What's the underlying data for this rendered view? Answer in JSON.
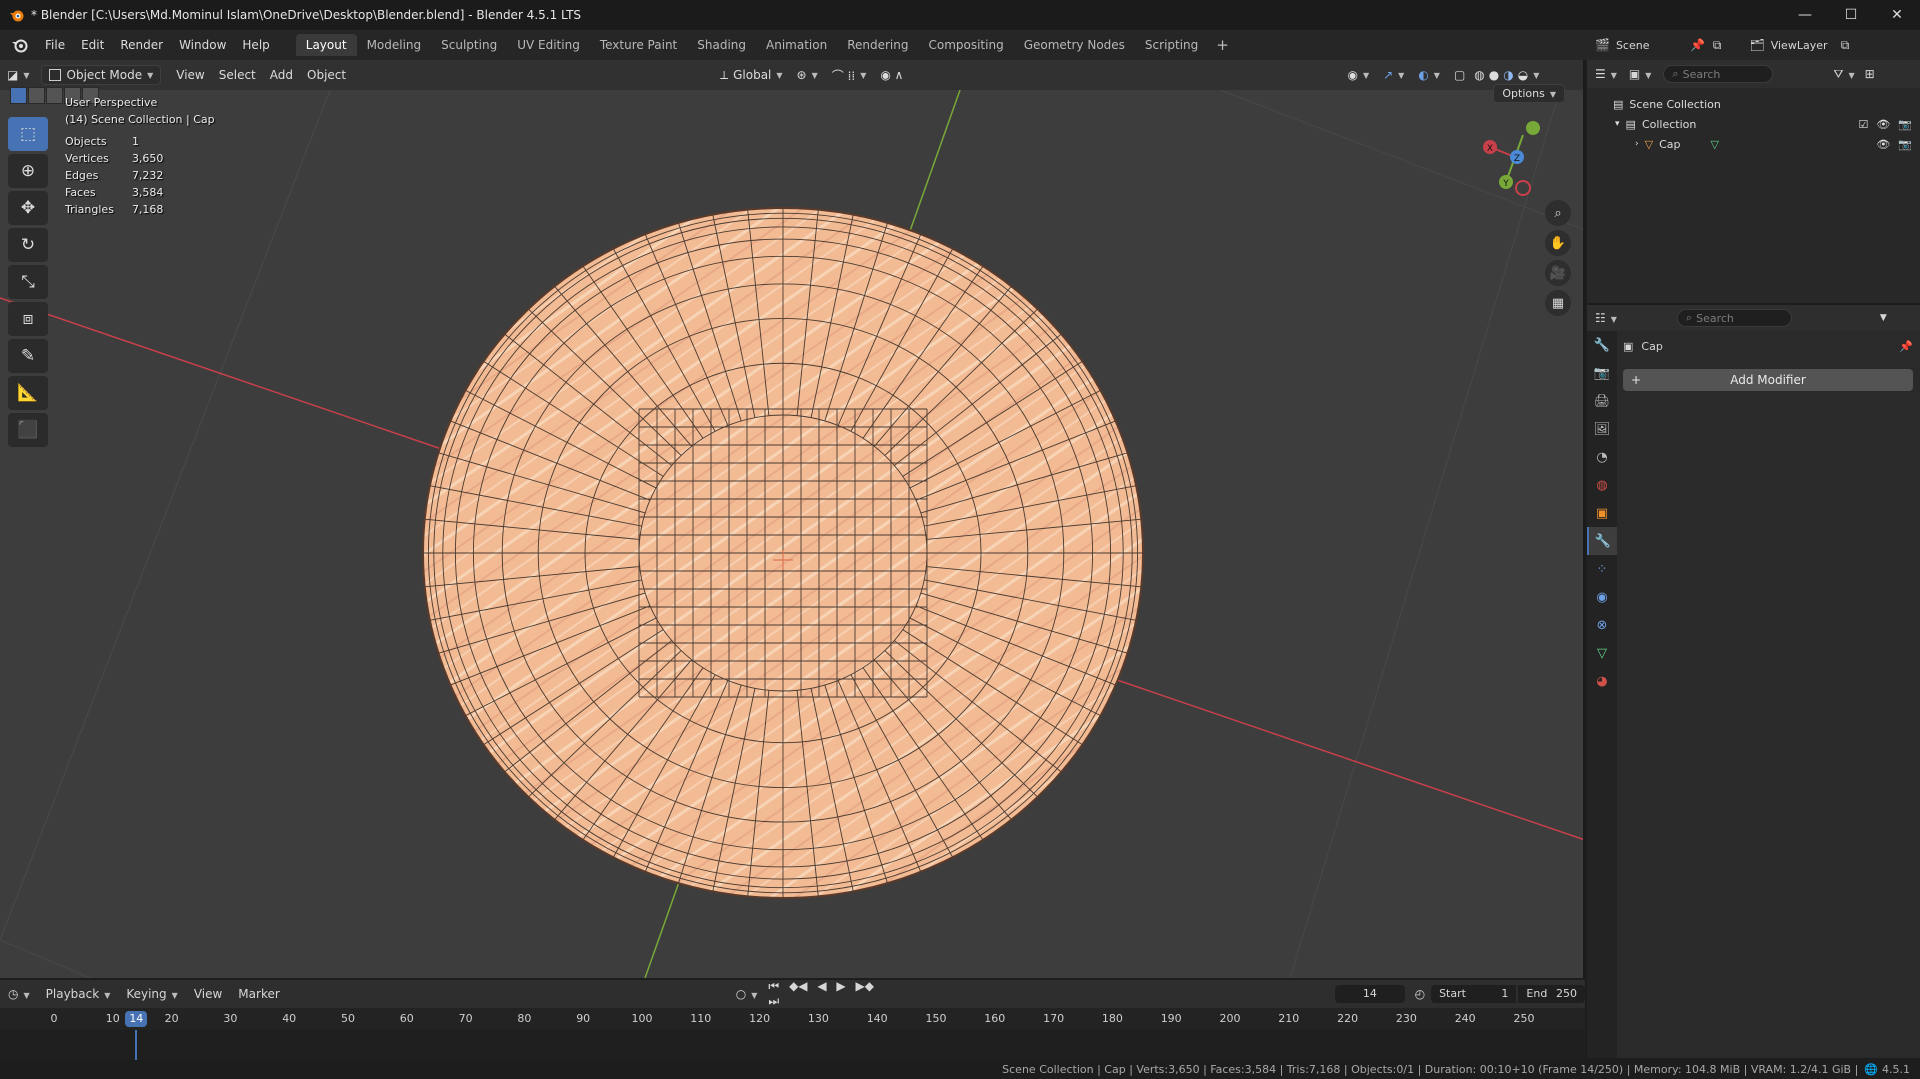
{
  "window": {
    "title": "* Blender [C:\\Users\\Md.Mominul Islam\\OneDrive\\Desktop\\Blender.blend] - Blender 4.5.1 LTS",
    "controls": [
      "—",
      "☐",
      "✕"
    ]
  },
  "menubar": {
    "menus": [
      "File",
      "Edit",
      "Render",
      "Window",
      "Help"
    ],
    "workspaces": [
      "Layout",
      "Modeling",
      "Sculpting",
      "UV Editing",
      "Texture Paint",
      "Shading",
      "Animation",
      "Rendering",
      "Compositing",
      "Geometry Nodes",
      "Scripting"
    ],
    "active_workspace": "Layout",
    "add_label": "+"
  },
  "viewport": {
    "mode": "Object Mode",
    "menus": [
      "View",
      "Select",
      "Add",
      "Object"
    ],
    "transform_orientation": "Global",
    "options_label": "Options",
    "overlay": {
      "perspective": "User Perspective",
      "context": "(14) Scene Collection | Cap",
      "stats": [
        {
          "label": "Objects",
          "value": "1"
        },
        {
          "label": "Vertices",
          "value": "3,650"
        },
        {
          "label": "Edges",
          "value": "7,232"
        },
        {
          "label": "Faces",
          "value": "3,584"
        },
        {
          "label": "Triangles",
          "value": "7,168"
        }
      ]
    },
    "gizmo_axes": {
      "x": "X",
      "y": "Y",
      "z": "Z"
    },
    "colors": {
      "background": "#3d3d3d",
      "mesh": "#f2bb94",
      "x_axis": "#c8404a",
      "y_axis": "#78a838",
      "accent": "#4772b3"
    }
  },
  "timeline": {
    "menus": [
      "Playback",
      "Keying",
      "View",
      "Marker"
    ],
    "current_frame": "14",
    "start_label": "Start",
    "start": "1",
    "end_label": "End",
    "end": "250",
    "ticks": [
      "0",
      "10",
      "20",
      "30",
      "40",
      "50",
      "60",
      "70",
      "80",
      "90",
      "100",
      "110",
      "120",
      "130",
      "140",
      "150",
      "160",
      "170",
      "180",
      "190",
      "200",
      "210",
      "220",
      "230",
      "240",
      "250"
    ]
  },
  "outliner": {
    "scene": "Scene",
    "view_layer": "ViewLayer",
    "search_placeholder": "Search",
    "root": "Scene Collection",
    "collection": "Collection",
    "object": "Cap"
  },
  "properties": {
    "search_placeholder": "Search",
    "object_name": "Cap",
    "add_modifier_label": "Add Modifier"
  },
  "statusbar": {
    "text": "Scene Collection | Cap | Verts:3,650 | Faces:3,584 | Tris:7,168 | Objects:0/1 | Duration: 00:10+10 (Frame 14/250) | Memory: 104.8 MiB | VRAM: 1.2/4.1 GiB |",
    "version": "4.5.1"
  }
}
